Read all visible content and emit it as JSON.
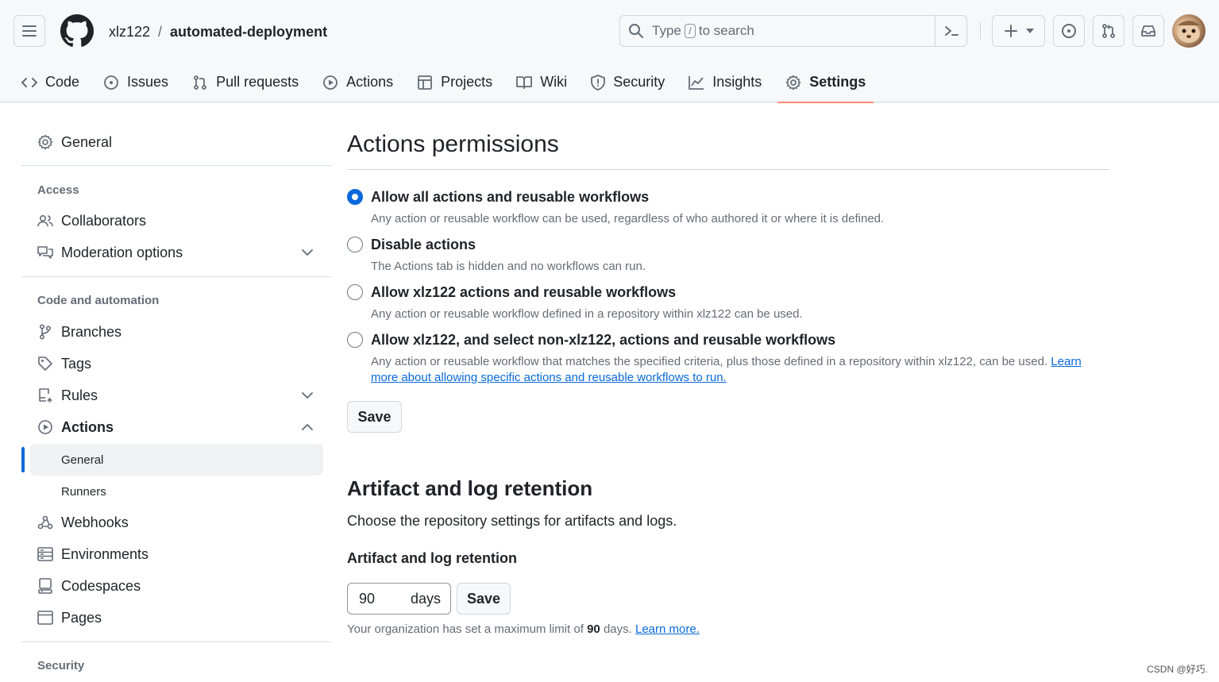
{
  "header": {
    "owner": "xlz122",
    "separator": "/",
    "repo": "automated-deployment",
    "search": {
      "prefix": "Type",
      "key": "/",
      "suffix": "to search"
    }
  },
  "repo_tabs": [
    {
      "label": "Code",
      "icon": "code-icon"
    },
    {
      "label": "Issues",
      "icon": "issue-icon"
    },
    {
      "label": "Pull requests",
      "icon": "pull-request-icon"
    },
    {
      "label": "Actions",
      "icon": "play-icon"
    },
    {
      "label": "Projects",
      "icon": "table-icon"
    },
    {
      "label": "Wiki",
      "icon": "book-icon"
    },
    {
      "label": "Security",
      "icon": "shield-icon"
    },
    {
      "label": "Insights",
      "icon": "graph-icon"
    },
    {
      "label": "Settings",
      "icon": "gear-icon",
      "active": true
    }
  ],
  "sidebar": {
    "general": "General",
    "access_heading": "Access",
    "collaborators": "Collaborators",
    "moderation": "Moderation options",
    "code_automation_heading": "Code and automation",
    "branches": "Branches",
    "tags": "Tags",
    "rules": "Rules",
    "actions": "Actions",
    "actions_general": "General",
    "actions_runners": "Runners",
    "webhooks": "Webhooks",
    "environments": "Environments",
    "codespaces": "Codespaces",
    "pages": "Pages",
    "security_heading": "Security"
  },
  "main": {
    "title": "Actions permissions",
    "options": [
      {
        "label": "Allow all actions and reusable workflows",
        "desc": "Any action or reusable workflow can be used, regardless of who authored it or where it is defined.",
        "checked": true
      },
      {
        "label": "Disable actions",
        "desc": "The Actions tab is hidden and no workflows can run.",
        "checked": false
      },
      {
        "label": "Allow xlz122 actions and reusable workflows",
        "desc": "Any action or reusable workflow defined in a repository within xlz122 can be used.",
        "checked": false
      },
      {
        "label": "Allow xlz122, and select non-xlz122, actions and reusable workflows",
        "desc": "Any action or reusable workflow that matches the specified criteria, plus those defined in a repository within xlz122, can be used.",
        "link": "Learn more about allowing specific actions and reusable workflows to run.",
        "checked": false
      }
    ],
    "save_label": "Save",
    "retention_title": "Artifact and log retention",
    "retention_desc": "Choose the repository settings for artifacts and logs.",
    "retention_subhead": "Artifact and log retention",
    "retention_value": "90",
    "retention_unit": "days",
    "retention_save": "Save",
    "note_prefix": "Your organization has set a maximum limit of",
    "note_max": "90",
    "note_suffix": "days.",
    "note_link": "Learn more."
  },
  "watermark": "CSDN @好巧.",
  "colors": {
    "accent": "#0969da",
    "tab_underline": "#fd8c73",
    "muted": "#656d76",
    "border": "#d0d7de"
  }
}
